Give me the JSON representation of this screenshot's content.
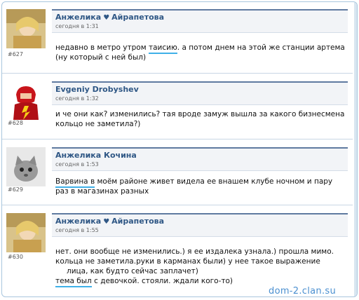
{
  "posts": [
    {
      "author": "Анжелика",
      "author_surname": "Айрапетова",
      "date": "сегодня в 1:31",
      "number": "#627",
      "lines": [
        "недавно в метро утром таисию. а потом днем на этой же станции артема",
        "(ну который с ней был)"
      ]
    },
    {
      "author": "Evgeniy Drobyshev",
      "date": "сегодня в 1:32",
      "number": "#628",
      "lines": [
        "и че они как? изменились? тая вроде замуж вышла за какого бизнесмена",
        "кольцо не заметила?)"
      ]
    },
    {
      "author": "Анжелика Кочина",
      "date": "сегодня в 1:53",
      "number": "#629",
      "lines": [
        "Варвина в моём районе живет видела ее внашем клубе ночном и пару",
        "раз в магазинах разных"
      ]
    },
    {
      "author": "Анжелика",
      "author_surname": "Айрапетова",
      "date": "сегодня в 1:55",
      "number": "#630",
      "lines": [
        "нет. они вообще не изменились.) я ее издалека узнала.) прошла мимо.",
        "кольца не заметила.руки в карманах были) у нее такое выражение",
        "лица, как будто сейчас заплачет)",
        "тема был с девочкой. стояли. ждали кого-то)"
      ]
    }
  ],
  "watermark": "dom-2.clan.su",
  "colors": {
    "author": "#2f5785",
    "underline": "#3fb0e8",
    "header_rule": "#5f7aa0"
  }
}
